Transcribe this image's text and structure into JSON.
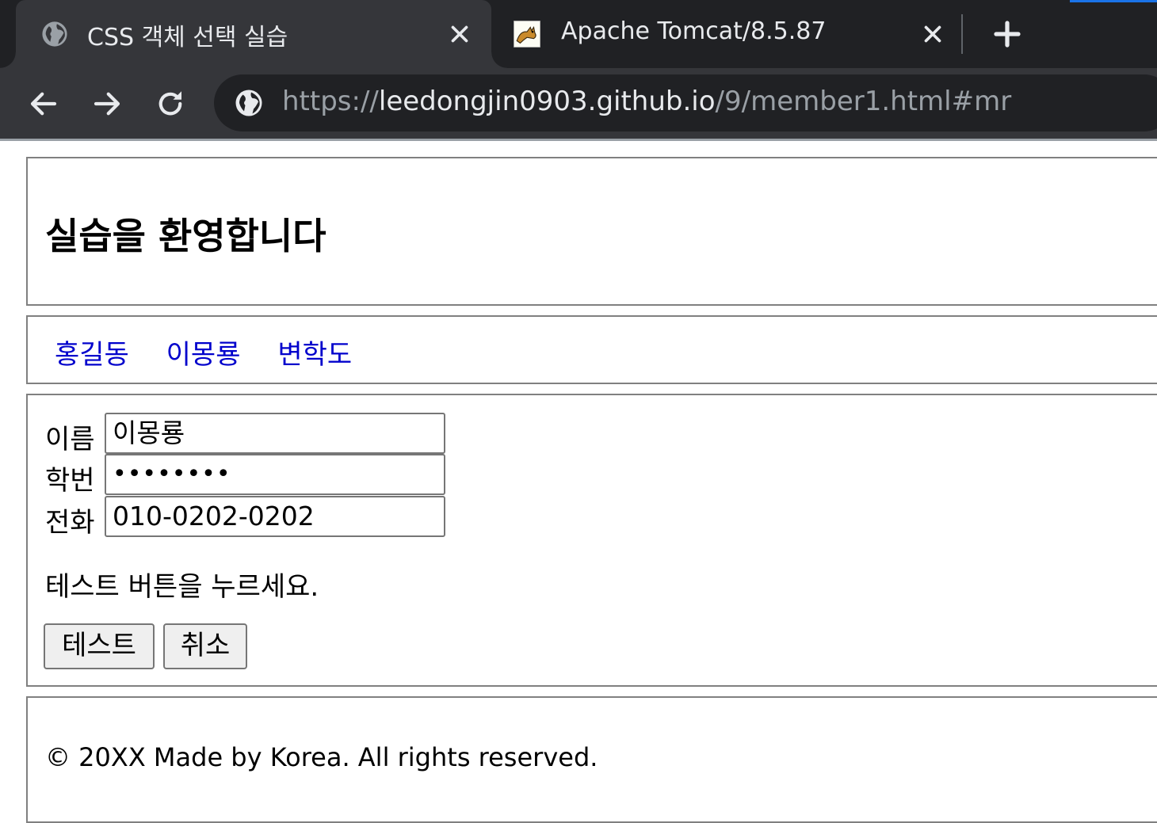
{
  "browser": {
    "tabs": [
      {
        "title": "CSS 객체 선택 실습",
        "favicon": "globe-icon",
        "active": true
      },
      {
        "title": "Apache Tomcat/8.5.87",
        "favicon": "tomcat-logo-icon",
        "active": false
      }
    ],
    "address": {
      "scheme": "https://",
      "host": "leedongjin0903.github.io",
      "path": "/9/member1.html#mr"
    },
    "colors": {
      "tabstrip": "#202124",
      "toolbar": "#35363a",
      "text": "#e8eaed"
    }
  },
  "page": {
    "heading": "실습을 환영합니다",
    "nav_links": [
      "홍길동",
      "이몽룡",
      "변학도"
    ],
    "form": {
      "name_label": "이름",
      "name_value": "이몽룡",
      "id_label": "학번",
      "id_value": "••••••••",
      "phone_label": "전화",
      "phone_value": "010-0202-0202"
    },
    "message": "테스트 버튼을 누르세요.",
    "buttons": {
      "test": "테스트",
      "cancel": "취소"
    },
    "footer": "© 20XX Made by Korea. All rights reserved.",
    "link_color": "#0000cc"
  }
}
